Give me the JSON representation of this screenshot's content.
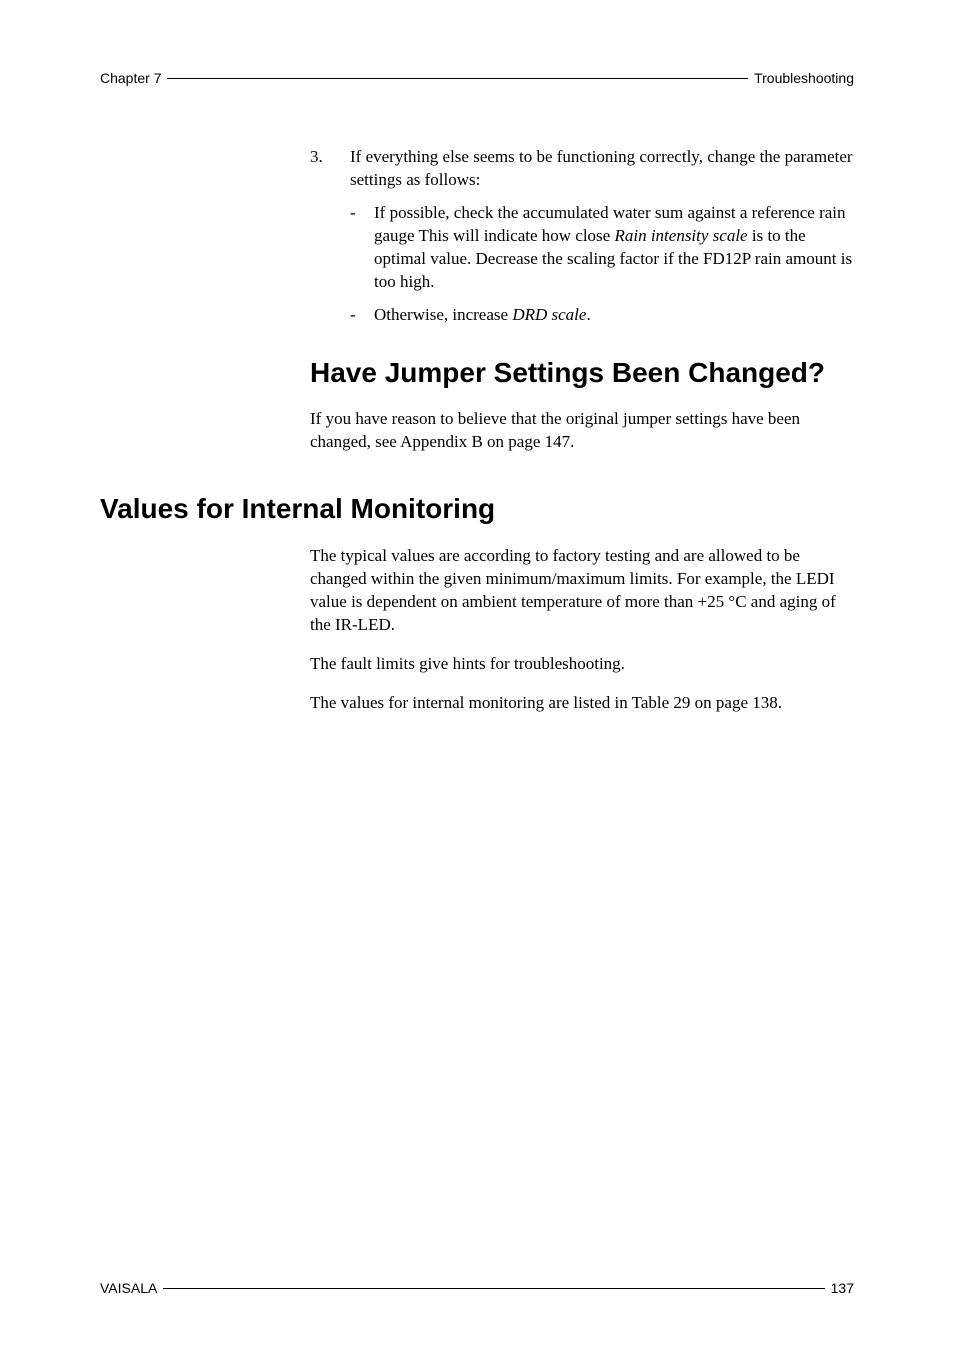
{
  "header": {
    "left": "Chapter 7",
    "right": "Troubleshooting"
  },
  "step3": {
    "num": "3.",
    "text_part1": "If everything else seems to be functioning correctly, change the parameter settings as follows:",
    "bullet1_prefix": "If possible, check the accumulated water sum against a reference rain gauge This will indicate how close ",
    "bullet1_italic": "Rain intensity scale",
    "bullet1_suffix": " is to the optimal value. Decrease the scaling factor if the FD12P rain amount is too high.",
    "bullet2_prefix": "Otherwise, increase ",
    "bullet2_italic": "DRD scale",
    "bullet2_suffix": "."
  },
  "sectionA": {
    "title": "Have Jumper Settings Been Changed?",
    "para": "If you have reason to believe that the original jumper settings have been changed, see Appendix B on page 147."
  },
  "sectionB": {
    "title": "Values for Internal Monitoring",
    "para1": "The typical values are according to factory testing and are allowed to be changed within the given minimum/maximum limits. For example, the LEDI value is dependent on ambient temperature of more than +25 °C and aging of the IR-LED.",
    "para2": "The fault limits give hints for troubleshooting.",
    "para3": "The values for internal monitoring are listed in Table 29 on page 138."
  },
  "footer": {
    "left": "VAISALA",
    "right": "137"
  }
}
